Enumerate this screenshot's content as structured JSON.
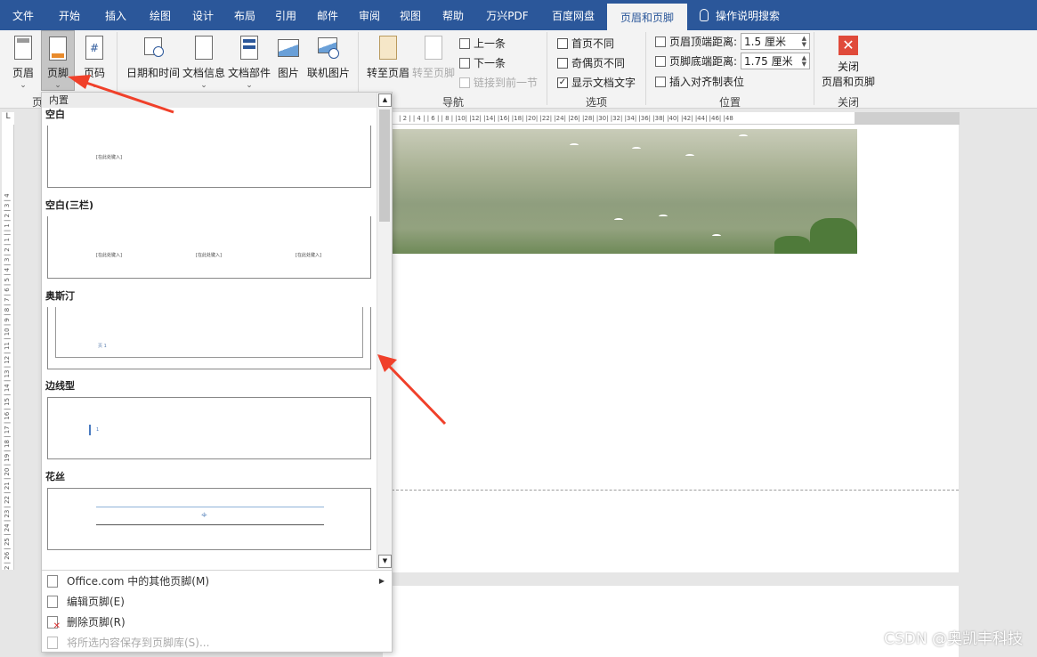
{
  "tabs": [
    "文件",
    "开始",
    "插入",
    "绘图",
    "设计",
    "布局",
    "引用",
    "邮件",
    "审阅",
    "视图",
    "帮助",
    "万兴PDF",
    "百度网盘",
    "页眉和页脚"
  ],
  "tell_me": "操作说明搜索",
  "ribbon": {
    "header_btn": "页眉",
    "footer_btn": "页脚",
    "page_num_btn": "页码",
    "group_hf_label": "页",
    "datetime_btn": "日期和时间",
    "docinfo_btn": "文档信息",
    "docparts_btn": "文档部件",
    "picture_btn": "图片",
    "online_pic_btn": "联机图片",
    "goto_header_btn": "转至页眉",
    "goto_footer_btn": "转至页脚",
    "prev_btn": "上一条",
    "next_btn": "下一条",
    "link_prev_btn": "链接到前一节",
    "nav_label": "导航",
    "opt_first_page": "首页不同",
    "opt_odd_even": "奇偶页不同",
    "opt_show_text": "显示文档文字",
    "options_label": "选项",
    "header_dist_label": "页眉顶端距离:",
    "header_dist_value": "1.5 厘米",
    "footer_dist_label": "页脚底端距离:",
    "footer_dist_value": "1.75 厘米",
    "insert_align_tab": "插入对齐制表位",
    "position_label": "位置",
    "close_btn_line1": "关闭",
    "close_btn_line2": "页眉和页脚",
    "close_label": "关闭"
  },
  "ruler_text": "| 2 |  | 4 |  | 6 |  | 8 |  |10|  |12|  |14|  |16|  |18|  |20|  |22|  |24|  |26|  |28|  |30|  |32|  |34|  |36|  |38|  |40|  |42|  |44|  |46|  |48",
  "ruler_left_text": "2 | 26 | 25 | 24 | 23 | 22 | 21 | 20 | 19 | 18 | 17 | 16 | 15 | 14 | 13 | 12 | 11 | 10 | 9 | 8 | 7 | 6 | 5 | 4 | 3 | 2 | 1 |  | 1 | 2 | 3 | 4",
  "dropdown": {
    "header": "内置",
    "items": [
      {
        "title": "空白",
        "placeholder": "[在此处键入]"
      },
      {
        "title": "空白(三栏)",
        "placeholder": "[在此处键入]"
      },
      {
        "title": "奥斯汀",
        "placeholder": "页 1"
      },
      {
        "title": "边线型",
        "placeholder": "1"
      },
      {
        "title": "花丝",
        "placeholder": ""
      }
    ],
    "menu": [
      {
        "label": "Office.com 中的其他页脚(M)",
        "disabled": false
      },
      {
        "label": "编辑页脚(E)",
        "disabled": false
      },
      {
        "label": "删除页脚(R)",
        "disabled": false
      },
      {
        "label": "将所选内容保存到页脚库(S)...",
        "disabled": true
      }
    ]
  },
  "watermark": "CSDN @奥凯丰科技",
  "colors": {
    "accent": "#2b579a",
    "arrow": "#f0402a",
    "close_red": "#e04a3a"
  }
}
